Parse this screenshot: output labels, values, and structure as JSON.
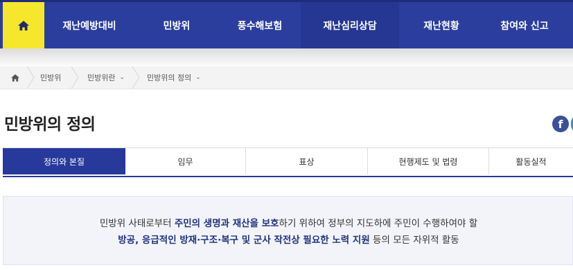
{
  "topnav": {
    "home_icon": "home-icon",
    "items": [
      "재난예방대비",
      "민방위",
      "풍수해보험",
      "재난심리상담",
      "재난현황",
      "참여와 신고"
    ]
  },
  "breadcrumb": {
    "home_icon": "home-icon",
    "items": [
      "민방위",
      "민방위란",
      "민방위의 정의"
    ]
  },
  "page": {
    "title": "민방위의 정의",
    "share_icon": "facebook-icon",
    "share_letter": "f"
  },
  "tabs": [
    "정의와 본질",
    "임무",
    "표상",
    "현행제도 및 법령",
    "활동실적"
  ],
  "definition": {
    "line1_pre": "민방위 사태로부터 ",
    "line1_hl": "주민의 생명과 재산을 보호",
    "line1_post": "하기 위하여 정부의 지도하에 주민이 수행하여야 할",
    "line2_hl": "방공, 응급적인 방재·구조·복구 및 군사 작전상 필요한 노력 지원",
    "line2_post": " 등의 모든 자위적 활동"
  },
  "colors": {
    "nav_bg": "#2b3e9e",
    "home_bg": "#f6e62c",
    "tab_active": "#27399a",
    "highlight_text": "#22337f"
  }
}
